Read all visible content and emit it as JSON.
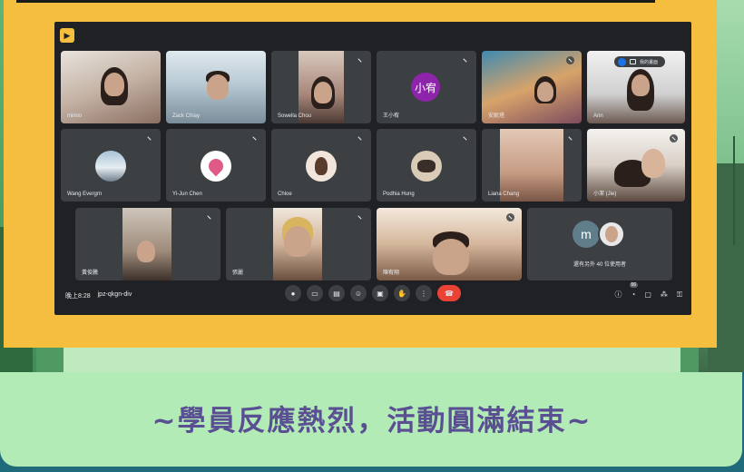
{
  "meet": {
    "meeting_time": "晚上8:28",
    "meeting_code": "jpz-qkgn-div",
    "others_text": "還有另外 40 位使用者",
    "others_initial": "m",
    "participants_badge": "56",
    "pin_bar_text": "我的畫面"
  },
  "participants": [
    {
      "name": "mimio"
    },
    {
      "name": "Zack Chiay"
    },
    {
      "name": "Sowella Chou"
    },
    {
      "name": "王小宥",
      "initials": "小宥",
      "avatar_color": "#8e24aa"
    },
    {
      "name": "安妮塔"
    },
    {
      "name": "Ann"
    },
    {
      "name": "Wang Evergrn"
    },
    {
      "name": "Yi-Jun Chen"
    },
    {
      "name": "Chloe"
    },
    {
      "name": "Podhia Hung"
    },
    {
      "name": "Liana Chang"
    },
    {
      "name": "小潔 (Jie)"
    },
    {
      "name": "黃俊騰"
    },
    {
      "name": "張麗"
    },
    {
      "name": "陳宥翔"
    }
  ],
  "banner": {
    "text": "~學員反應熱烈，活動圓滿結束~"
  },
  "colors": {
    "frame": "#f6be3e",
    "meet_bg": "#202124",
    "tile_bg": "#3c4043",
    "banner_bg": "#b3ebb6",
    "banner_text": "#5a4f93",
    "hangup": "#ea4335"
  }
}
